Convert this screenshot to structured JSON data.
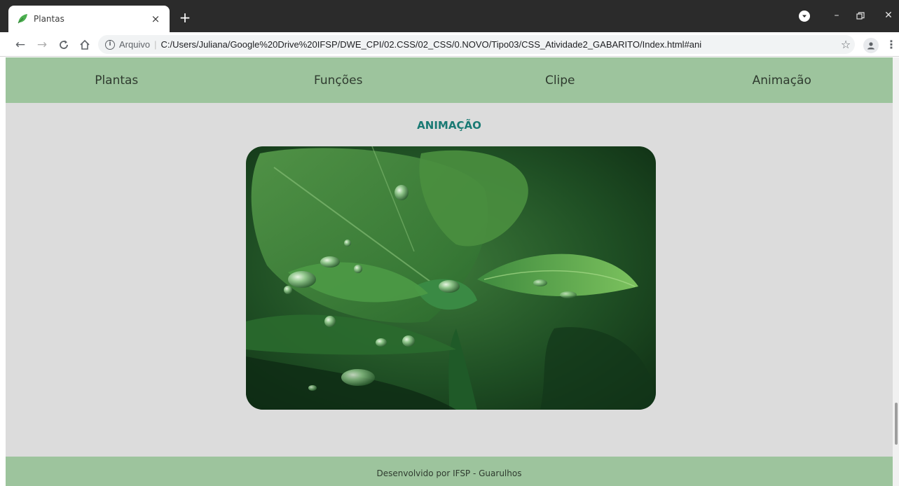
{
  "browser": {
    "tab_title": "Plantas",
    "tab_close": "×",
    "new_tab": "+",
    "url_scheme": "Arquivo",
    "url_separator": "|",
    "url": "C:/Users/Juliana/Google%20Drive%20IFSP/DWE_CPI/02.CSS/02_CSS/0.NOVO/Tipo03/CSS_Atividade2_GABARITO/Index.html#ani",
    "icons": [
      "back-arrow-icon",
      "forward-arrow-icon",
      "reload-icon",
      "home-icon",
      "info-icon",
      "bookmark-star-icon",
      "account-icon",
      "menu-icon",
      "leaf-favicon-icon"
    ]
  },
  "nav": {
    "items": [
      {
        "label": "Plantas"
      },
      {
        "label": "Funções"
      },
      {
        "label": "Clipe"
      },
      {
        "label": "Animação"
      }
    ]
  },
  "main": {
    "section_title": "ANIMAÇÃO",
    "image_alt": "leaf-with-water-droplets"
  },
  "footer": {
    "text": "Desenvolvido por IFSP - Guarulhos"
  },
  "colors": {
    "nav_bg": "#9dc49d",
    "page_bg": "#dcdcdc",
    "title_color": "#1a7a74",
    "footer_bg": "#9dc49d"
  }
}
